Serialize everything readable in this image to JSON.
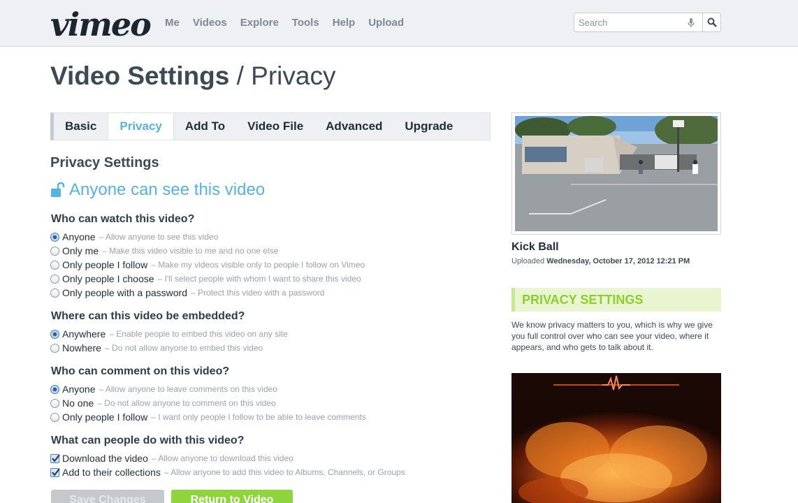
{
  "header": {
    "logo": "vimeo",
    "nav": [
      "Me",
      "Videos",
      "Explore",
      "Tools",
      "Help",
      "Upload"
    ],
    "search_placeholder": "Search"
  },
  "title": {
    "main": "Video Settings",
    "separator": "/",
    "sub": "Privacy"
  },
  "tabs": [
    {
      "label": "Basic",
      "active": false
    },
    {
      "label": "Privacy",
      "active": true
    },
    {
      "label": "Add To",
      "active": false
    },
    {
      "label": "Video File",
      "active": false
    },
    {
      "label": "Advanced",
      "active": false
    },
    {
      "label": "Upgrade",
      "active": false
    }
  ],
  "privacy": {
    "heading": "Privacy Settings",
    "status": "Anyone can see this video",
    "watch": {
      "question": "Who can watch this video?",
      "options": [
        {
          "label": "Anyone",
          "desc": "– Allow anyone to see this video",
          "checked": true
        },
        {
          "label": "Only me",
          "desc": "– Make this video visible to me and no one else",
          "checked": false
        },
        {
          "label": "Only people I follow",
          "desc": "– Make my videos visible only to people I follow on Vimeo",
          "checked": false
        },
        {
          "label": "Only people I choose",
          "desc": "– I'll select people with whom I want to share this video",
          "checked": false
        },
        {
          "label": "Only people with a password",
          "desc": "– Protect this video with a password",
          "checked": false
        }
      ]
    },
    "embed": {
      "question": "Where can this video be embedded?",
      "options": [
        {
          "label": "Anywhere",
          "desc": "– Enable people to embed this video on any site",
          "checked": true
        },
        {
          "label": "Nowhere",
          "desc": "– Do not allow anyone to embed this video",
          "checked": false
        }
      ]
    },
    "comment": {
      "question": "Who can comment on this video?",
      "options": [
        {
          "label": "Anyone",
          "desc": "– Allow anyone to leave comments on this video",
          "checked": true
        },
        {
          "label": "No one",
          "desc": "– Do not allow anyone to comment on this video",
          "checked": false
        },
        {
          "label": "Only people I follow",
          "desc": "– I want only people I follow to be able to leave comments",
          "checked": false
        }
      ]
    },
    "actions": {
      "question": "What can people do with this video?",
      "options": [
        {
          "label": "Download the video",
          "desc": "– Allow anyone to download this video",
          "checked": true
        },
        {
          "label": "Add to their collections",
          "desc": "– Allow anyone to add this video to Albums, Channels, or Groups",
          "checked": true
        }
      ]
    }
  },
  "buttons": {
    "save": "Save Changes",
    "return": "Return to Video"
  },
  "sidebar": {
    "video_title": "Kick Ball",
    "uploaded_prefix": "Uploaded",
    "uploaded_date": "Wednesday, October 17, 2012 12:21 PM",
    "promo_heading": "PRIVACY SETTINGS",
    "promo_text": "We know privacy matters to you, which is why we give you full control over who can see your video, where it appears, and who gets to talk about it."
  },
  "colors": {
    "accent_blue": "#55b3dc",
    "accent_green": "#8dcd2e",
    "button_green": "#8fd43a"
  }
}
